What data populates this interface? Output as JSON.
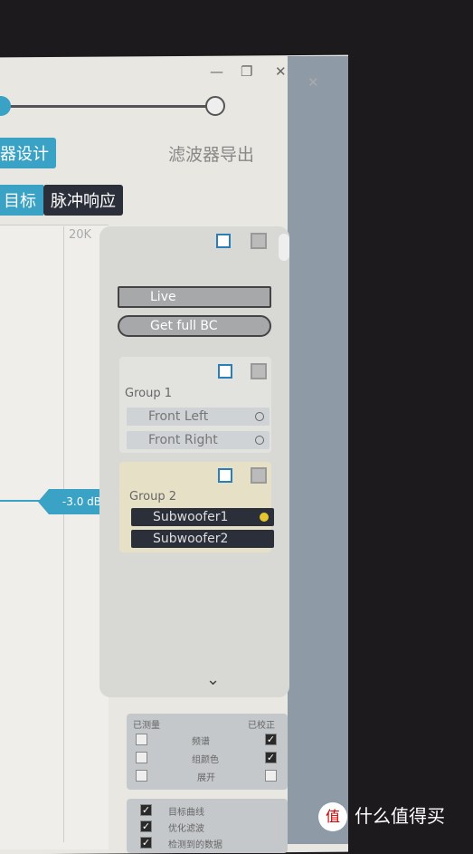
{
  "window": {
    "minimize": "—",
    "restore": "❐",
    "close": "✕",
    "outer_close": "✕"
  },
  "steps": {
    "current_label": "器设计",
    "next_label": "滤波器导出"
  },
  "tabs": {
    "target": "目标",
    "impulse": "脉冲响应"
  },
  "plot": {
    "freq_max": "20K",
    "level_tag": "-3.0 dB"
  },
  "panel": {
    "live": "Live",
    "get_full_bc": "Get full BC",
    "groups": [
      {
        "label": "Group 1",
        "channels": [
          "Front Left",
          "Front Right"
        ]
      },
      {
        "label": "Group 2",
        "channels": [
          "Subwoofer1",
          "Subwoofer2"
        ]
      }
    ],
    "expand_icon": "chevron-down"
  },
  "options": {
    "measured": "已测量",
    "corrected": "已校正",
    "rows": [
      {
        "label": "频谱",
        "measured": false,
        "corrected": true
      },
      {
        "label": "组颜色",
        "measured": false,
        "corrected": true
      },
      {
        "label": "展开",
        "measured": false,
        "corrected": false
      }
    ]
  },
  "display": {
    "rows": [
      {
        "label": "目标曲线",
        "checked": true
      },
      {
        "label": "优化滤波",
        "checked": true
      },
      {
        "label": "检测到的数据",
        "checked": true
      }
    ]
  },
  "watermark": {
    "text": "什么值得买",
    "logo": "值"
  },
  "colors": {
    "accent": "#3aa2c4",
    "dark_tab": "#2b2f3a",
    "group2_bg": "#e6e0c6",
    "selected_dot": "#e6c530"
  }
}
